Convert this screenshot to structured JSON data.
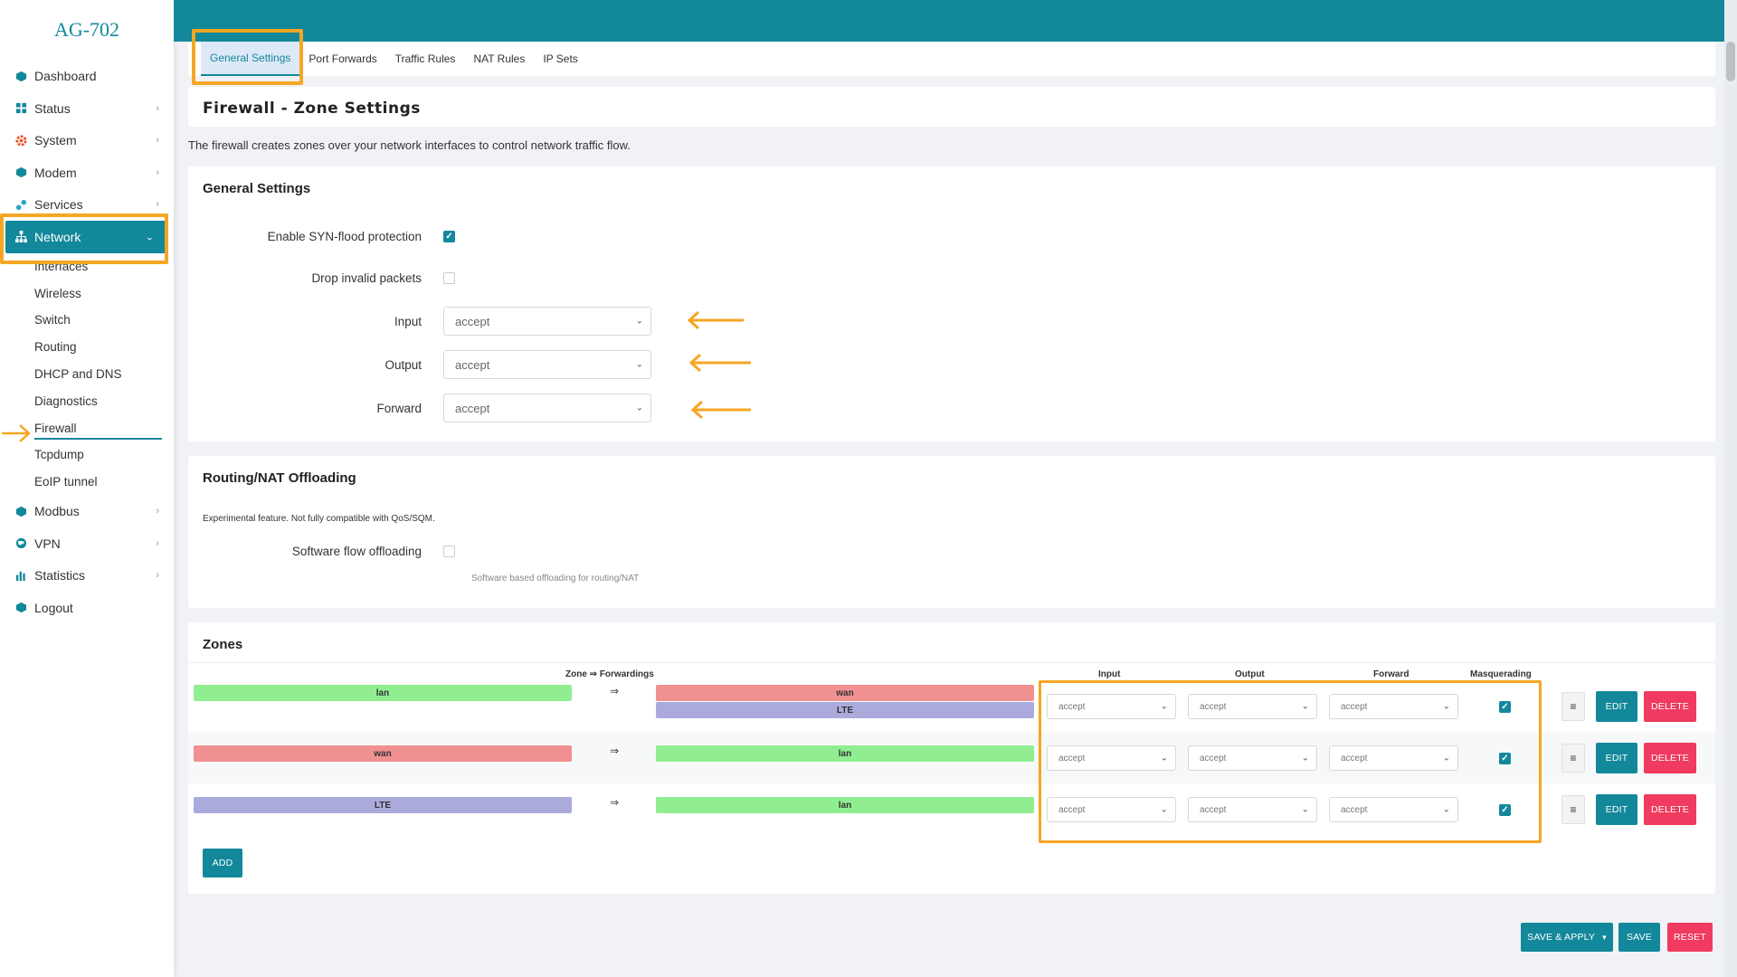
{
  "brand": "AG-702",
  "sidebar": {
    "items": [
      {
        "label": "Dashboard",
        "icon": "cube-icon"
      },
      {
        "label": "Status",
        "icon": "grid-icon"
      },
      {
        "label": "System",
        "icon": "gear-icon"
      },
      {
        "label": "Modem",
        "icon": "cube-icon"
      },
      {
        "label": "Services",
        "icon": "puzzle-icon"
      },
      {
        "label": "Network",
        "icon": "network-icon"
      }
    ],
    "network_sub": [
      "Interfaces",
      "Wireless",
      "Switch",
      "Routing",
      "DHCP and DNS",
      "Diagnostics",
      "Firewall",
      "Tcpdump",
      "EoIP tunnel"
    ],
    "items_after": [
      {
        "label": "Modbus",
        "icon": "cube-icon"
      },
      {
        "label": "VPN",
        "icon": "globe-icon"
      },
      {
        "label": "Statistics",
        "icon": "bar-chart-icon"
      },
      {
        "label": "Logout",
        "icon": "cube-icon"
      }
    ]
  },
  "tabs": [
    "General Settings",
    "Port Forwards",
    "Traffic Rules",
    "NAT Rules",
    "IP Sets"
  ],
  "page_title": "Firewall - Zone Settings",
  "description": "The firewall creates zones over your network interfaces to control network traffic flow.",
  "general": {
    "title": "General Settings",
    "syn_label": "Enable SYN-flood protection",
    "syn_checked": true,
    "drop_label": "Drop invalid packets",
    "drop_checked": false,
    "input_label": "Input",
    "input_value": "accept",
    "output_label": "Output",
    "output_value": "accept",
    "forward_label": "Forward",
    "forward_value": "accept"
  },
  "offload": {
    "title": "Routing/NAT Offloading",
    "note": "Experimental feature. Not fully compatible with QoS/SQM.",
    "sw_label": "Software flow offloading",
    "sw_hint": "Software based offloading for routing/NAT"
  },
  "zones": {
    "title": "Zones",
    "headers": {
      "zone": "Zone ⇒ Forwardings",
      "input": "Input",
      "output": "Output",
      "forward": "Forward",
      "masq": "Masquerading"
    },
    "rows": [
      {
        "zone": "lan",
        "eq": "⇒",
        "forwards": [
          "wan",
          "LTE"
        ],
        "input": "accept",
        "output": "accept",
        "forward": "accept",
        "masq": true
      },
      {
        "zone": "wan",
        "eq": "⇒",
        "forwards": [
          "lan"
        ],
        "input": "accept",
        "output": "accept",
        "forward": "accept",
        "masq": true
      },
      {
        "zone": "LTE",
        "eq": "⇒",
        "forwards": [
          "lan"
        ],
        "input": "accept",
        "output": "accept",
        "forward": "accept",
        "masq": true
      }
    ],
    "edit_label": "EDIT",
    "delete_label": "DELETE",
    "handle_label": "≡",
    "add_label": "ADD"
  },
  "footer": {
    "save_apply": "SAVE & APPLY",
    "save": "SAVE",
    "reset": "RESET"
  },
  "colors": {
    "accent": "#13889b",
    "lan": "#90ee90",
    "wan": "#f09090",
    "lte": "#aaaadd",
    "danger": "#f03a5f",
    "highlight": "#f5a623"
  }
}
